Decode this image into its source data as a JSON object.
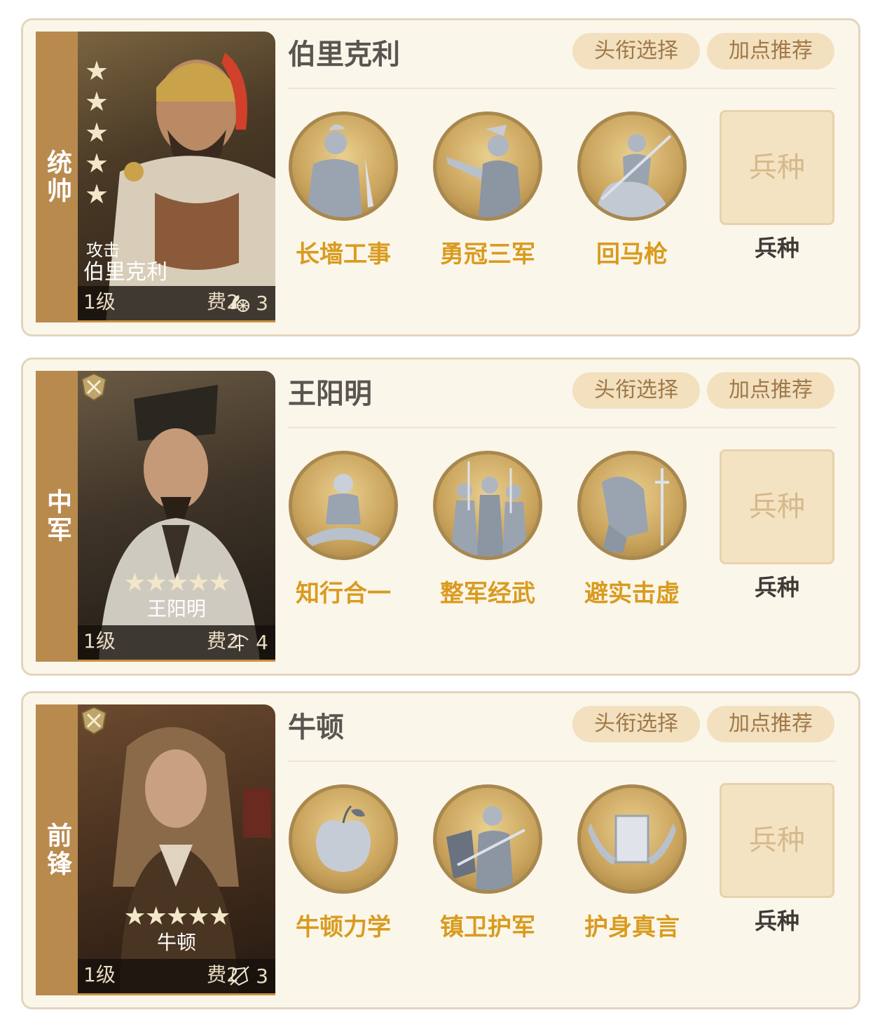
{
  "buttons": {
    "title_select": "头衔选择",
    "stat_recommend": "加点推荐"
  },
  "troop": {
    "box_text": "兵种",
    "label": "兵种"
  },
  "colors": {
    "panel_bg": "#fbf6ea",
    "strip": "#b98a4e",
    "skill_name": "#d99b1f",
    "pill_bg": "#f2e0bf"
  },
  "heroes": [
    {
      "role": "统帅",
      "name": "伯里克利",
      "card": {
        "type": "攻击",
        "name": "伯里克利",
        "level": "1级",
        "cost": "费2",
        "troop_value": "3",
        "troop_icon": "chariot-icon",
        "stars": 5
      },
      "skills": [
        {
          "name": "长墙工事",
          "icon": "soldier-sword-icon"
        },
        {
          "name": "勇冠三军",
          "icon": "commander-pointing-icon"
        },
        {
          "name": "回马枪",
          "icon": "cavalry-spear-icon"
        }
      ]
    },
    {
      "role": "中军",
      "name": "王阳明",
      "card": {
        "name": "王阳明",
        "level": "1级",
        "cost": "费2",
        "troop_value": "4",
        "troop_icon": "crossbow-icon",
        "stars": 5
      },
      "skills": [
        {
          "name": "知行合一",
          "icon": "meditating-monk-icon"
        },
        {
          "name": "整军经武",
          "icon": "soldier-squad-icon"
        },
        {
          "name": "避实击虚",
          "icon": "kneeling-swordsman-icon"
        }
      ]
    },
    {
      "role": "前锋",
      "name": "牛顿",
      "card": {
        "name": "牛顿",
        "level": "1级",
        "cost": "费2",
        "troop_value": "3",
        "troop_icon": "shield-spear-icon",
        "stars": 5
      },
      "skills": [
        {
          "name": "牛顿力学",
          "icon": "apple-icon"
        },
        {
          "name": "镇卫护军",
          "icon": "shield-knight-icon"
        },
        {
          "name": "护身真言",
          "icon": "hands-scroll-icon"
        }
      ]
    }
  ]
}
